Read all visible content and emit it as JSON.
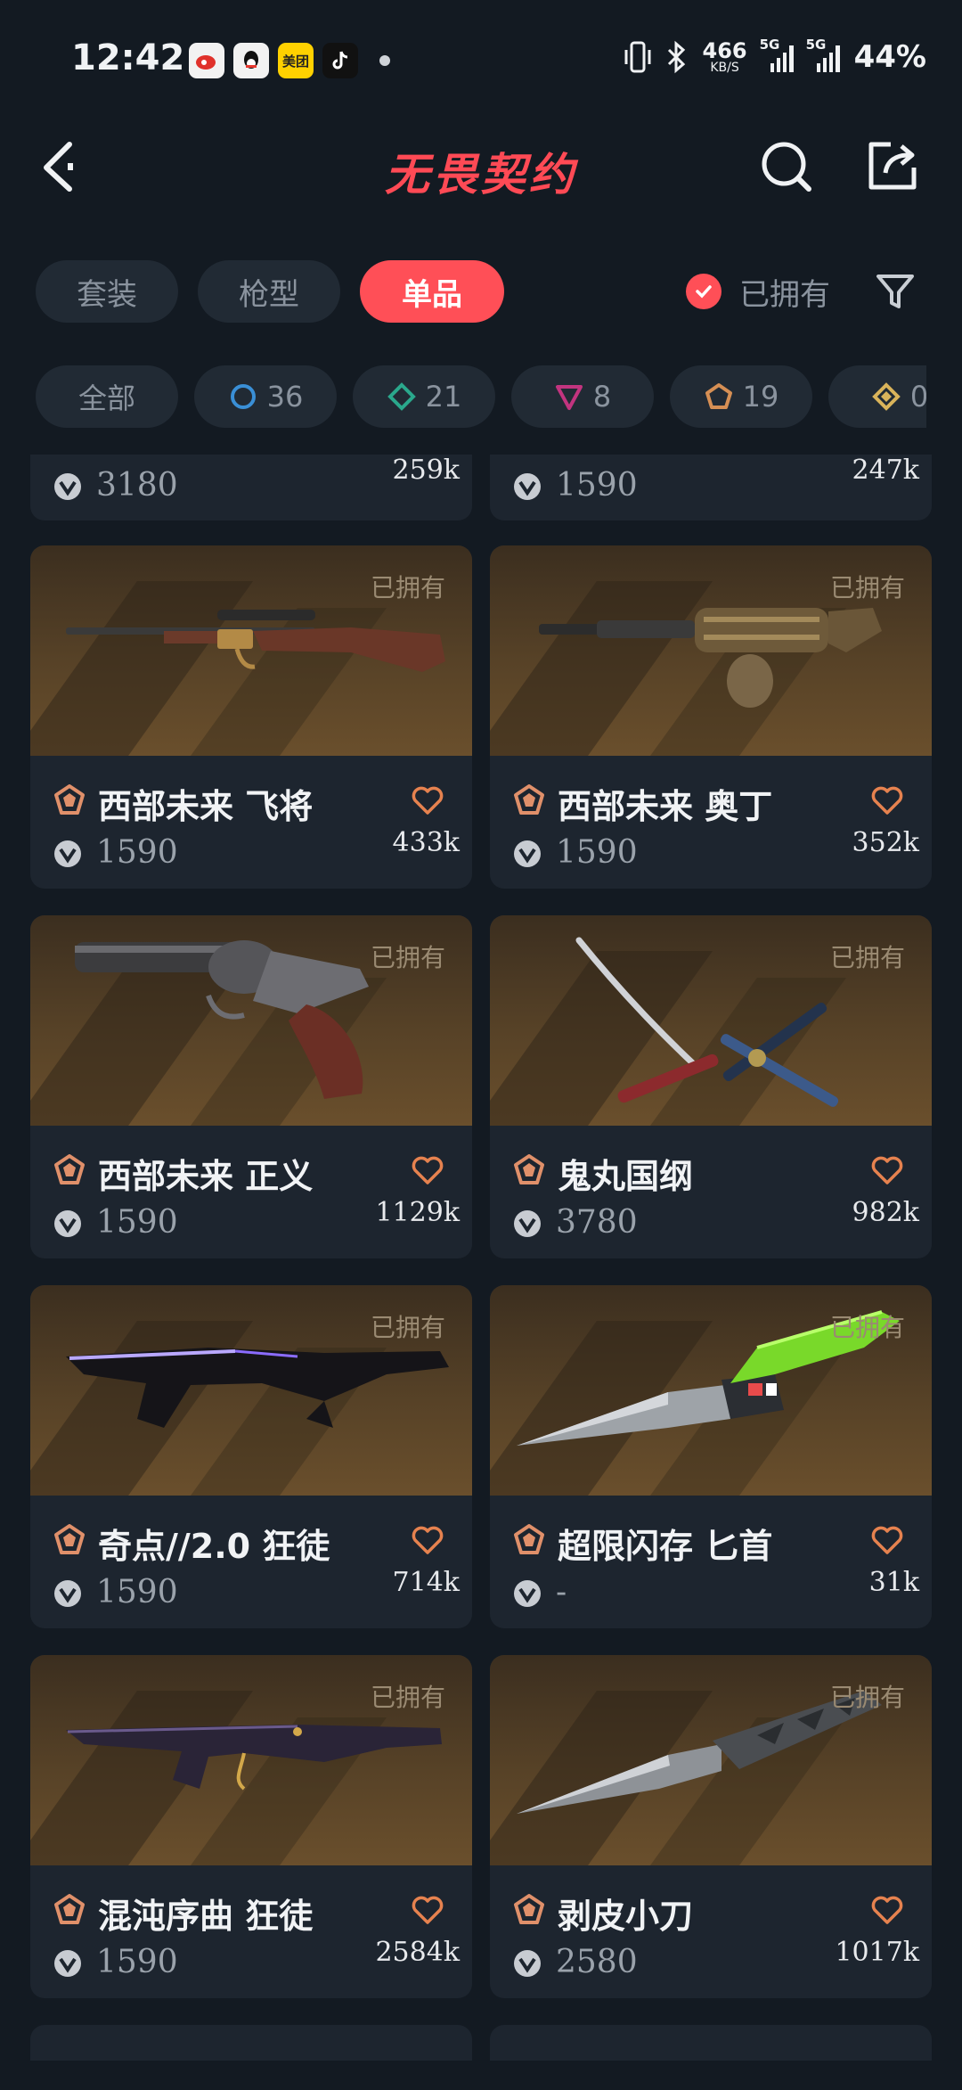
{
  "status_bar": {
    "time": "12:42",
    "apps": [
      {
        "icon": "weibo-app-icon",
        "label": "",
        "color": "#f2f2f2"
      },
      {
        "icon": "qq-app-icon",
        "label": "",
        "color": "#f2f2f2"
      },
      {
        "icon": "meituan-app-icon",
        "label": "美团",
        "color": "#ffd100"
      },
      {
        "icon": "tiktok-app-icon",
        "label": "",
        "color": "#111111"
      }
    ],
    "net_speed": "466",
    "net_unit": "KB/S",
    "signal1_tag": "5G",
    "signal2_tag": "5G",
    "battery": "44%"
  },
  "header": {
    "title": "无畏契约",
    "title_color": "#ff4a55"
  },
  "tabs": [
    {
      "label": "套装",
      "active": false
    },
    {
      "label": "枪型",
      "active": false
    },
    {
      "label": "单品",
      "active": true
    }
  ],
  "owned_filter": {
    "label": "已拥有",
    "checked": true
  },
  "rarity_chips": [
    {
      "label": "全部",
      "icon": ""
    },
    {
      "label": "36",
      "icon": "select-tier-icon",
      "color": "#3a8fd6"
    },
    {
      "label": "21",
      "icon": "deluxe-tier-icon",
      "color": "#2aa88c"
    },
    {
      "label": "8",
      "icon": "premium-tier-icon",
      "color": "#c2347f"
    },
    {
      "label": "19",
      "icon": "exclusive-tier-icon",
      "color": "#d68f54"
    },
    {
      "label": "0",
      "icon": "ultra-tier-icon",
      "color": "#d9b35a"
    }
  ],
  "owned_badge": "已拥有",
  "partial_cards": [
    {
      "price": "3180",
      "likes": "259k"
    },
    {
      "price": "1590",
      "likes": "247k"
    }
  ],
  "cards": [
    {
      "name": "西部未来 飞将",
      "price": "1590",
      "likes": "433k",
      "weapon": "marshal-rifle-image"
    },
    {
      "name": "西部未来 奥丁",
      "price": "1590",
      "likes": "352k",
      "weapon": "odin-machinegun-image"
    },
    {
      "name": "西部未来 正义",
      "price": "1590",
      "likes": "1129k",
      "weapon": "sheriff-revolver-image"
    },
    {
      "name": "鬼丸国纲",
      "price": "3780",
      "likes": "982k",
      "weapon": "katana-image"
    },
    {
      "name": "奇点//2.0 狂徒",
      "price": "1590",
      "likes": "714k",
      "weapon": "vandal-rifle-image"
    },
    {
      "name": "超限闪存 匕首",
      "price": "-",
      "likes": "31k",
      "weapon": "green-dagger-image"
    },
    {
      "name": "混沌序曲 狂徒",
      "price": "1590",
      "likes": "2584k",
      "weapon": "vandal-purple-rifle-image"
    },
    {
      "name": "剥皮小刀",
      "price": "2580",
      "likes": "1017k",
      "weapon": "skinning-knife-image"
    }
  ]
}
